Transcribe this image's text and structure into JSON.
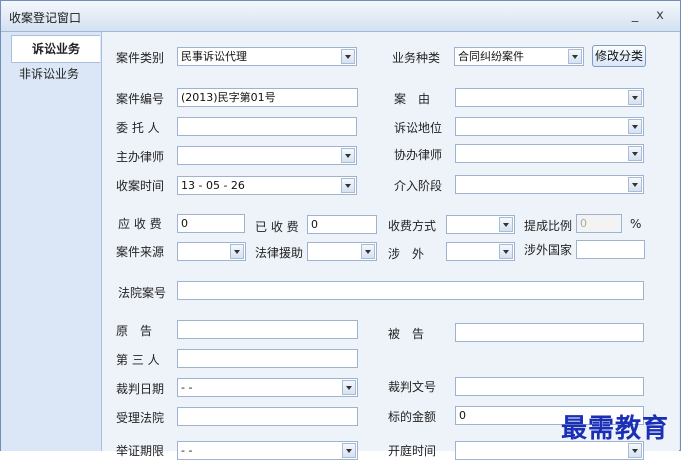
{
  "window": {
    "title": "收案登记窗口",
    "minimize": "_",
    "close": "x"
  },
  "sidebar": {
    "tabs": [
      "诉讼业务",
      "非诉讼业务"
    ]
  },
  "form": {
    "case_type": {
      "label": "案件类别",
      "value": "民事诉讼代理"
    },
    "business_type": {
      "label": "业务种类",
      "value": "合同纠纷案件"
    },
    "modify_button": "修改分类",
    "case_no": {
      "label": "案件编号",
      "value": "(2013)民字第01号"
    },
    "cause": {
      "label": "案　由",
      "value": ""
    },
    "client": {
      "label": "委 托 人",
      "value": ""
    },
    "litigation_status": {
      "label": "诉讼地位",
      "value": ""
    },
    "lead_lawyer": {
      "label": "主办律师",
      "value": ""
    },
    "assist_lawyer": {
      "label": "协办律师",
      "value": ""
    },
    "receive_time": {
      "label": "收案时间",
      "value": "13 - 05 - 26"
    },
    "stage": {
      "label": "介入阶段",
      "value": ""
    },
    "fee_due": {
      "label": "应 收 费",
      "value": "0"
    },
    "fee_received": {
      "label": "已 收 费",
      "value": "0"
    },
    "fee_method": {
      "label": "收费方式",
      "value": ""
    },
    "commission": {
      "label": "提成比例",
      "value": "0",
      "unit": "%"
    },
    "case_source": {
      "label": "案件来源",
      "value": ""
    },
    "legal_aid": {
      "label": "法律援助",
      "value": ""
    },
    "foreign": {
      "label": "涉　外",
      "value": ""
    },
    "foreign_country": {
      "label": "涉外国家",
      "value": ""
    },
    "court_case_no": {
      "label": "法院案号",
      "value": ""
    },
    "plaintiff": {
      "label": "原　告",
      "value": ""
    },
    "defendant": {
      "label": "被　告",
      "value": ""
    },
    "third_party": {
      "label": "第 三 人",
      "value": ""
    },
    "judgment_date": {
      "label": "裁判日期",
      "value": "  -    -"
    },
    "judgment_doc_no": {
      "label": "裁判文号",
      "value": ""
    },
    "accepting_court": {
      "label": "受理法院",
      "value": ""
    },
    "subject_amount": {
      "label": "标的金额",
      "value": "0"
    },
    "evidence_deadline": {
      "label": "举证期限",
      "value": "  -    -"
    },
    "hearing_time": {
      "label": "开庭时间",
      "value": ""
    }
  },
  "watermark": "最需教育",
  "colors": {
    "panel_bg": "#eef3fa",
    "sidebar_bg": "#dbe7f6",
    "watermark": "#1a2fb5"
  }
}
